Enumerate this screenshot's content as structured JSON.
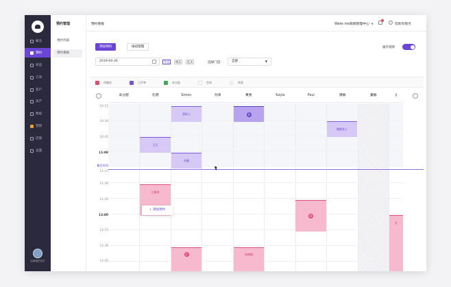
{
  "sidebar": {
    "items": [
      {
        "label": "概况",
        "icon": "overview-icon"
      },
      {
        "label": "预约",
        "icon": "calendar-icon",
        "active": true
      },
      {
        "label": "商品",
        "icon": "product-icon"
      },
      {
        "label": "订单",
        "icon": "order-icon"
      },
      {
        "label": "客户",
        "icon": "customer-icon"
      },
      {
        "label": "资产",
        "icon": "asset-icon"
      },
      {
        "label": "数据",
        "icon": "data-icon"
      },
      {
        "label": "营销",
        "icon": "marketing-icon"
      },
      {
        "label": "店铺",
        "icon": "store-icon"
      },
      {
        "label": "设置",
        "icon": "settings-icon"
      }
    ],
    "store_name": "店铺组织名字"
  },
  "subnav": {
    "title": "预约管理",
    "items": [
      {
        "label": "预约列表"
      },
      {
        "label": "预约看板"
      }
    ]
  },
  "topbar": {
    "breadcrumb": "预约看板",
    "store": "Wake me款辞管理中心",
    "help": "帮助和服务"
  },
  "toolbar": {
    "add_label": "添加预约",
    "schedule_label": "排班管理",
    "show_tech_label": "展示技师",
    "show_tech_on": true
  },
  "filters": {
    "date": "2019-04-30",
    "today": "今天",
    "tomorrow": "明天",
    "day_after": "后天",
    "shop_label": "选择门店:",
    "shop_value": "全部"
  },
  "legend": [
    {
      "label": "待服务",
      "color": "#e8456f"
    },
    {
      "label": "已开单",
      "color": "#7653d8"
    },
    {
      "label": "未分配",
      "color": "#3eab57"
    },
    {
      "label": "空闲",
      "color": "#ffffff"
    },
    {
      "label": "休息",
      "color": "#eeeeee"
    }
  ],
  "columns": [
    "未分配",
    "孔明",
    "Simon",
    "孙泽",
    "黄勇",
    "Kayla",
    "Paul",
    "康静",
    "董静",
    "ji"
  ],
  "times": [
    "10:15",
    "10:30",
    "10:45",
    "11:00",
    "最近时间",
    "11:15",
    "11:30",
    "11:45",
    "12:00",
    "12:15",
    "12:30",
    "12:45"
  ],
  "appointments": {
    "simon_1030": "郑彩士",
    "huang_1030": "4",
    "kang_1040": "娜娜女士",
    "kong_1050": "王玉",
    "simon_1100": "刘童",
    "kong_1130": "江勇泉",
    "paul_1145": "8",
    "simon_1230": "2",
    "huang_1230": "张朝娟",
    "last_col": "东"
  },
  "add_appointment": "+ 添加预约"
}
